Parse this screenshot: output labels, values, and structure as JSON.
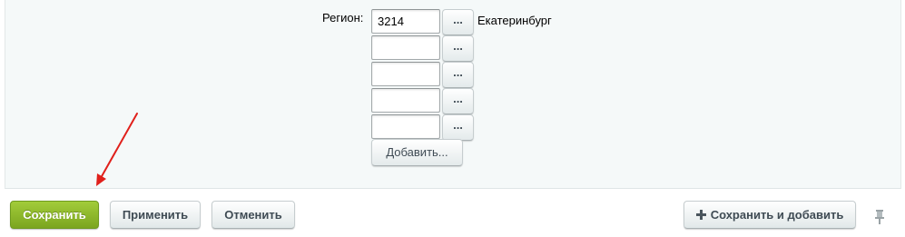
{
  "form": {
    "region_label": "Регион:",
    "regions": [
      {
        "value": "3214",
        "name": "Екатеринбург",
        "browse_label": "..."
      },
      {
        "value": "",
        "name": "",
        "browse_label": "..."
      },
      {
        "value": "",
        "name": "",
        "browse_label": "..."
      },
      {
        "value": "",
        "name": "",
        "browse_label": "..."
      },
      {
        "value": "",
        "name": "",
        "browse_label": "..."
      }
    ],
    "add_label": "Добавить..."
  },
  "footer": {
    "save_label": "Сохранить",
    "apply_label": "Применить",
    "cancel_label": "Отменить",
    "save_add_label": "Сохранить и добавить",
    "save_add_icon": "plus-icon",
    "pin_icon": "pin-icon"
  },
  "colors": {
    "save_button": "#8ab82b",
    "panel_bg": "#f5f9f9",
    "annotation_arrow": "#e0201b"
  }
}
